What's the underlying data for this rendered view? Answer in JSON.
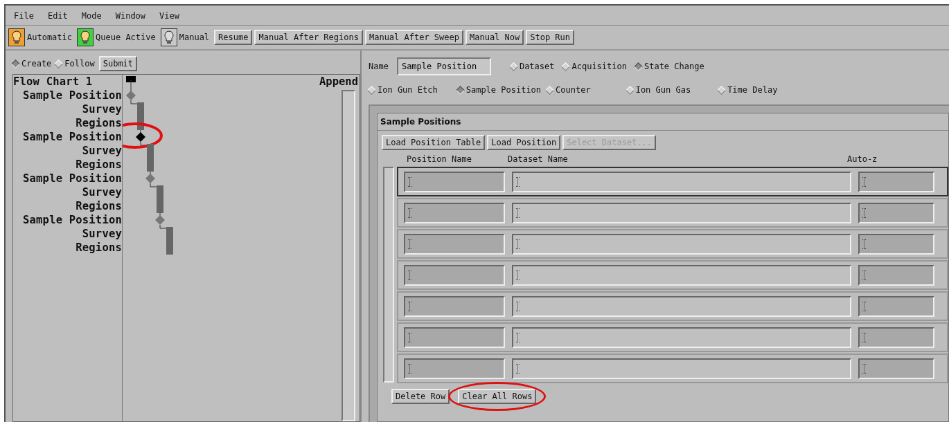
{
  "menu": [
    "File",
    "Edit",
    "Mode",
    "Window",
    "View"
  ],
  "modes": [
    {
      "label": "Automatic",
      "color": "#f0a030"
    },
    {
      "label": "Queue Active",
      "color": "#40d040"
    },
    {
      "label": "Manual",
      "color": "#c8c8c8"
    }
  ],
  "actions": [
    "Resume",
    "Manual After Regions",
    "Manual After Sweep",
    "Manual Now",
    "Stop Run"
  ],
  "left": {
    "options": [
      {
        "label": "Create",
        "selected": true
      },
      {
        "label": "Follow",
        "selected": false
      }
    ],
    "submit": "Submit",
    "title": "Flow Chart 1",
    "append": "Append",
    "flow": [
      {
        "label": "Sample Position",
        "kind": "position",
        "selected": false,
        "circled": false
      },
      {
        "label": "Survey",
        "kind": "step",
        "selected": false,
        "circled": false
      },
      {
        "label": "Regions",
        "kind": "step",
        "selected": false,
        "circled": false
      },
      {
        "label": "Sample Position",
        "kind": "position",
        "selected": true,
        "circled": true
      },
      {
        "label": "Survey",
        "kind": "step",
        "selected": false,
        "circled": false
      },
      {
        "label": "Regions",
        "kind": "step",
        "selected": false,
        "circled": false
      },
      {
        "label": "Sample Position",
        "kind": "position",
        "selected": false,
        "circled": false
      },
      {
        "label": "Survey",
        "kind": "step",
        "selected": false,
        "circled": false
      },
      {
        "label": "Regions",
        "kind": "step",
        "selected": false,
        "circled": false
      },
      {
        "label": "Sample Position",
        "kind": "position",
        "selected": false,
        "circled": false
      },
      {
        "label": "Survey",
        "kind": "step",
        "selected": false,
        "circled": false
      },
      {
        "label": "Regions",
        "kind": "step",
        "selected": false,
        "circled": false
      }
    ]
  },
  "name_label": "Name",
  "name_value": "Sample Position",
  "types_row1": [
    {
      "label": "Dataset",
      "selected": false
    },
    {
      "label": "Acquisition",
      "selected": false
    },
    {
      "label": "State Change",
      "selected": true
    }
  ],
  "types_row2": [
    {
      "label": "Ion Gun Etch",
      "selected": false
    },
    {
      "label": "Sample Position",
      "selected": true
    },
    {
      "label": "Counter",
      "selected": false
    },
    {
      "label": "Ion Gun Gas",
      "selected": false
    },
    {
      "label": "Time Delay",
      "selected": false
    }
  ],
  "group": {
    "title": "Sample Positions",
    "buttons": [
      {
        "label": "Load Position Table",
        "disabled": false
      },
      {
        "label": "Load Position",
        "disabled": false
      },
      {
        "label": "Select Dataset...",
        "disabled": true
      }
    ],
    "columns": [
      "Position Name",
      "Dataset Name",
      "Auto-z"
    ],
    "rows": [
      {
        "focused": true
      },
      {
        "focused": false
      },
      {
        "focused": false
      },
      {
        "focused": false
      },
      {
        "focused": false
      },
      {
        "focused": false
      },
      {
        "focused": false
      }
    ],
    "bottom": [
      {
        "label": "Delete Row",
        "circled": false
      },
      {
        "label": "Clear All Rows",
        "circled": true
      }
    ]
  }
}
